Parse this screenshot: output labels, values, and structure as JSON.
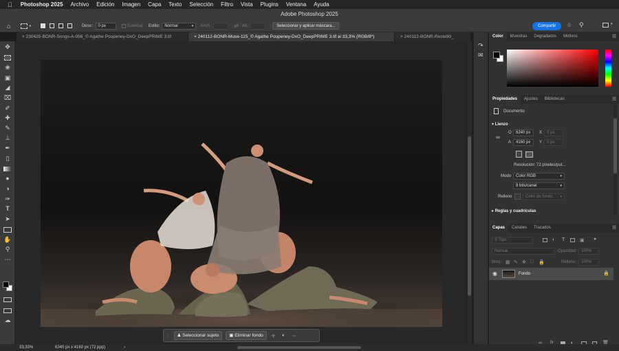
{
  "menubar": {
    "app_name": "Photoshop 2025",
    "items": [
      "Archivo",
      "Edición",
      "Imagen",
      "Capa",
      "Texto",
      "Selección",
      "Filtro",
      "Vista",
      "Plugins",
      "Ventana",
      "Ayuda"
    ]
  },
  "window_title": "Adobe Photoshop 2025",
  "options_bar": {
    "feather_label": "Desv.:",
    "feather_value": "0 px",
    "smooth_label": "Suavizar",
    "style_label": "Estilo:",
    "style_value": "Normal",
    "width_label": "Anch.:",
    "height_label": "Alt.:",
    "mask_button": "Seleccionar y aplicar máscara...",
    "share_button": "Compartir"
  },
  "document_tabs": [
    {
      "label": "230425-BONR-Songs-A-056_© Agathe Poupeney-DxO_DeepPRIME 3.tif",
      "active": false
    },
    {
      "label": "240112-BONR-Muse-115_© Agathe Poupeney-DxO_DeepPRIME 3.tif al 33,3% (RGB/8*)",
      "active": true
    },
    {
      "label": "240112-BONR-Reste90_",
      "active": false
    }
  ],
  "color_panel": {
    "tabs": [
      "Color",
      "Muestras",
      "Degradados",
      "Motivos"
    ],
    "active_tab": "Color",
    "base_hue": "#ff0000"
  },
  "properties_panel": {
    "tabs": [
      "Propiedades",
      "Ajustes",
      "Bibliotecas"
    ],
    "doc_label": "Documento",
    "canvas_section": "Lienzo",
    "w_label": "O",
    "w_value": "6240 px",
    "h_label": "A",
    "h_value": "4160 px",
    "x_label": "X",
    "x_placeholder": "0 px",
    "y_label": "Y",
    "y_placeholder": "0 px",
    "resolution": "Resolución: 72 píxeles/pul...",
    "mode_label": "Modo",
    "mode_value": "Color RGB",
    "bits_value": "8 bits/canal",
    "fill_label": "Relleno",
    "fill_value": "Color de fondo",
    "rulers_section": "Reglas y cuadrículas"
  },
  "layers_panel": {
    "tabs": [
      "Capas",
      "Canales",
      "Trazados"
    ],
    "filter_value": "Tipo",
    "blend_value": "Normal",
    "opacity_label": "Opacidad:",
    "opacity_value": "100%",
    "lock_label": "Bloq.:",
    "fill_label": "Relleno:",
    "fill_value": "100%",
    "layers": [
      {
        "name": "Fondo",
        "visible": true,
        "locked": true
      }
    ]
  },
  "context_bar": {
    "select_subject": "Seleccionar sujeto",
    "remove_bg": "Eliminar fondo"
  },
  "status_bar": {
    "zoom": "33,33%",
    "doc_info": "6240 px x 4160 px (72 ppp)"
  }
}
